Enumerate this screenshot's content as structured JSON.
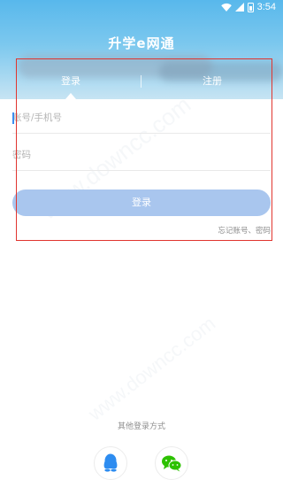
{
  "status_bar": {
    "time": "3:54"
  },
  "app": {
    "title": "升学e网通"
  },
  "tabs": [
    {
      "label": "登录",
      "active": true
    },
    {
      "label": "注册",
      "active": false
    }
  ],
  "form": {
    "account_placeholder": "账号/手机号",
    "password_placeholder": "密码",
    "login_button": "登录",
    "forgot_link": "忘记账号、密码"
  },
  "other_login": {
    "label": "其他登录方式",
    "providers": [
      "qq",
      "wechat"
    ]
  },
  "colors": {
    "header": "#5bb8ec",
    "login_button": "#a9c6ee",
    "highlight": "#e0352f",
    "qq": "#2d8cf0",
    "wechat": "#2dc100"
  },
  "icons": {
    "wifi": "wifi-icon",
    "signal": "signal-icon",
    "battery": "battery-icon",
    "qq": "qq-icon",
    "wechat": "wechat-icon"
  }
}
